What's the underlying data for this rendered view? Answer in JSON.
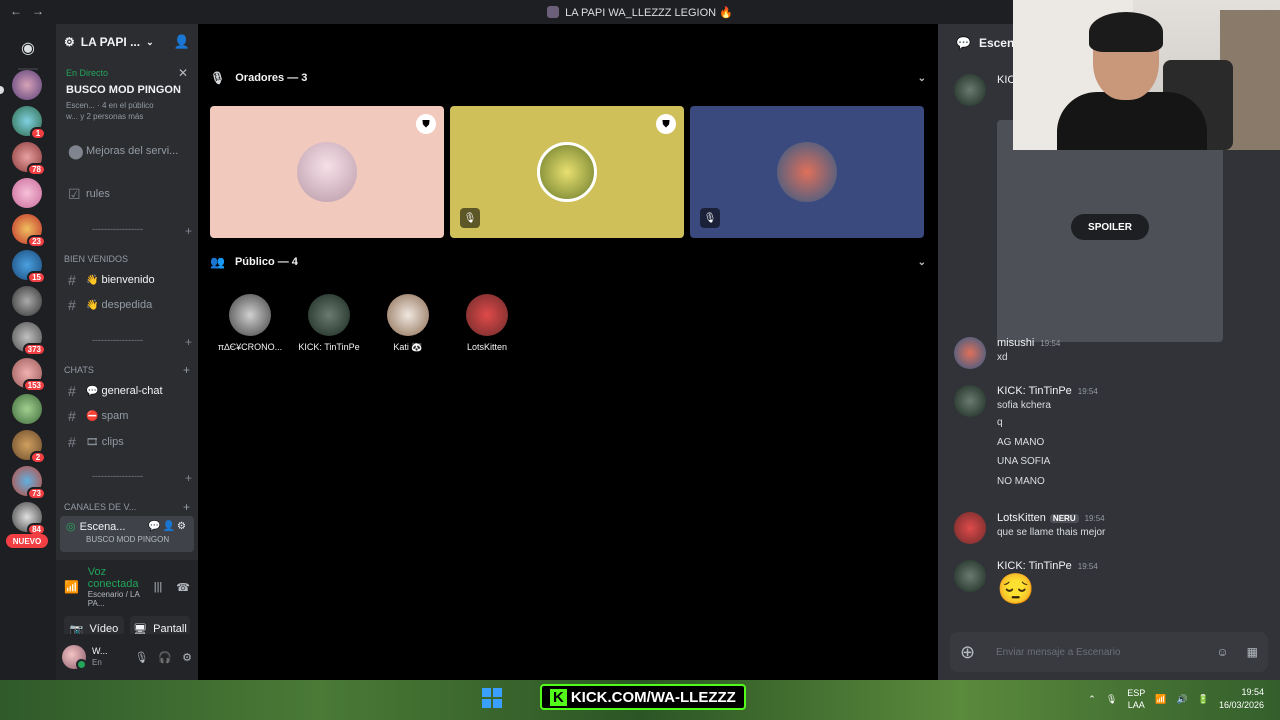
{
  "titlebar": {
    "title": "LA PAPI WA_LLEZZZ LEGION 🔥"
  },
  "rail": {
    "badges": [
      "1",
      "78",
      "23",
      "15",
      "373",
      "153",
      "2",
      "73",
      "84"
    ],
    "nuevo": "NUEVO"
  },
  "server": {
    "name": "LA PAPI ..."
  },
  "event": {
    "live": "En Directo",
    "title": "BUSCO MOD PINGON",
    "meta1": "Escen... · 4 en el público",
    "meta2": "w... y 2 personas más"
  },
  "channels": {
    "mejoras": "Mejoras del servi...",
    "rules": "rules",
    "cat_bienvenidos": "BIEN VENIDOS",
    "bienvenido": "bienvenido",
    "despedida": "despedida",
    "cat_chats": "CHATS",
    "general": "general-chat",
    "spam": "spam",
    "clips": "clips",
    "cat_voice": "CANALES DE V...",
    "active_name": "Escena...",
    "active_sub": "BUSCO MOD PINGON",
    "divider": "-----------------"
  },
  "voice": {
    "status": "Voz conectada",
    "location": "Escenario / LA PA...",
    "video": "Vídeo",
    "screen": "Pantall"
  },
  "user": {
    "name": "W...",
    "status": "En"
  },
  "stage": {
    "speakers_header": "Oradores — 3",
    "audience_header": "Público — 4",
    "audience": [
      "π∆Є¥CRONO...",
      "KICK: TinTinPe",
      "Kati 🐼",
      "LotsKitten"
    ]
  },
  "chat": {
    "title": "Escenario",
    "spoiler": "SPOILER",
    "partial_author": "KICK",
    "messages": [
      {
        "author": "misushi",
        "time": "19:54",
        "lines": [
          "xd"
        ]
      },
      {
        "author": "KICK: TinTinPe",
        "time": "19:54",
        "lines": [
          "sofia kchera",
          "q",
          "AG MANO",
          "UNA SOFIA",
          "NO MANO"
        ]
      },
      {
        "author": "LotsKitten",
        "tag": "NERU",
        "time": "19:54",
        "lines": [
          "que se llame thais mejor"
        ]
      },
      {
        "author": "KICK: TinTinPe",
        "time": "19:54",
        "emoji": "😔"
      }
    ],
    "placeholder": "Enviar mensaje a Escenario"
  },
  "taskbar": {
    "kick_k": "K",
    "kick_text": "KICK.COM/WA-LLEZZZ",
    "lang": "ESP",
    "lang_sub": "LAA",
    "time": "19:54",
    "date": "16/03/2026"
  },
  "colors": {
    "accent_green": "#23a55a",
    "danger": "#f23f43",
    "kick_green": "#53fc18"
  }
}
